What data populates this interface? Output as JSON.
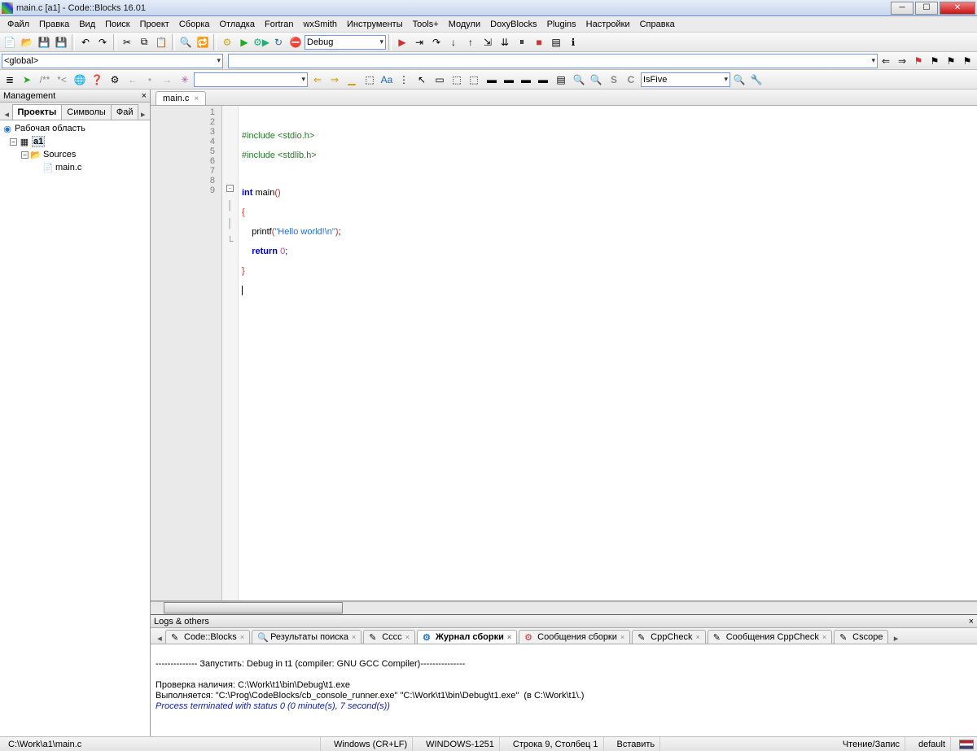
{
  "window": {
    "title": "main.c [a1] - Code::Blocks 16.01"
  },
  "menu": [
    "Файл",
    "Правка",
    "Вид",
    "Поиск",
    "Проект",
    "Сборка",
    "Отладка",
    "Fortran",
    "wxSmith",
    "Инструменты",
    "Tools+",
    "Модули",
    "DoxyBlocks",
    "Plugins",
    "Настройки",
    "Справка"
  ],
  "toolbar1": {
    "build_target": "Debug"
  },
  "toolbar2": {
    "scope": "<global>",
    "symbol_combo": ""
  },
  "toolbar3": {
    "search_combo": "",
    "match_combo": "IsFive"
  },
  "management": {
    "title": "Management",
    "tabs": [
      "Проекты",
      "Символы",
      "Фай"
    ],
    "active_tab": 0,
    "tree": {
      "workspace": "Рабочая область",
      "project": "a1",
      "sources": "Sources",
      "file": "main.c"
    }
  },
  "editor": {
    "tab": "main.c",
    "lines": [
      "1",
      "2",
      "3",
      "4",
      "5",
      "6",
      "7",
      "8",
      "9"
    ]
  },
  "code": {
    "l1a": "#include ",
    "l1b": "<stdio.h>",
    "l2a": "#include ",
    "l2b": "<stdlib.h>",
    "l4a": "int",
    "l4b": " main",
    "l4c": "()",
    "l5": "{",
    "l6a": "    printf",
    "l6b": "(",
    "l6c": "\"Hello world!\\n\"",
    "l6d": ")",
    "l6e": ";",
    "l7a": "    ",
    "l7b": "return",
    "l7c": " ",
    "l7d": "0",
    "l7e": ";",
    "l8": "}"
  },
  "logs": {
    "title": "Logs & others",
    "tabs": [
      "Code::Blocks",
      "Результаты поиска",
      "Cccc",
      "Журнал сборки",
      "Сообщения сборки",
      "CppCheck",
      "Сообщения CppCheck",
      "Cscope"
    ],
    "active_tab": 3,
    "body_line0": "",
    "body_line1": "-------------- Запустить: Debug in t1 (compiler: GNU GCC Compiler)---------------",
    "body_line2": "",
    "body_line3": "Проверка наличия: C:\\Work\\t1\\bin\\Debug\\t1.exe",
    "body_line4": "Выполняется: \"C:\\Prog\\CodeBlocks/cb_console_runner.exe\" \"C:\\Work\\t1\\bin\\Debug\\t1.exe\"  (в C:\\Work\\t1\\.)",
    "body_line5": "Process terminated with status 0 (0 minute(s), 7 second(s))"
  },
  "status": {
    "path": "C:\\Work\\a1\\main.c",
    "eol": "Windows (CR+LF)",
    "encoding": "WINDOWS-1251",
    "pos": "Строка 9, Столбец 1",
    "mode": "Вставить",
    "rw": "Чтение/Запис",
    "profile": "default"
  }
}
